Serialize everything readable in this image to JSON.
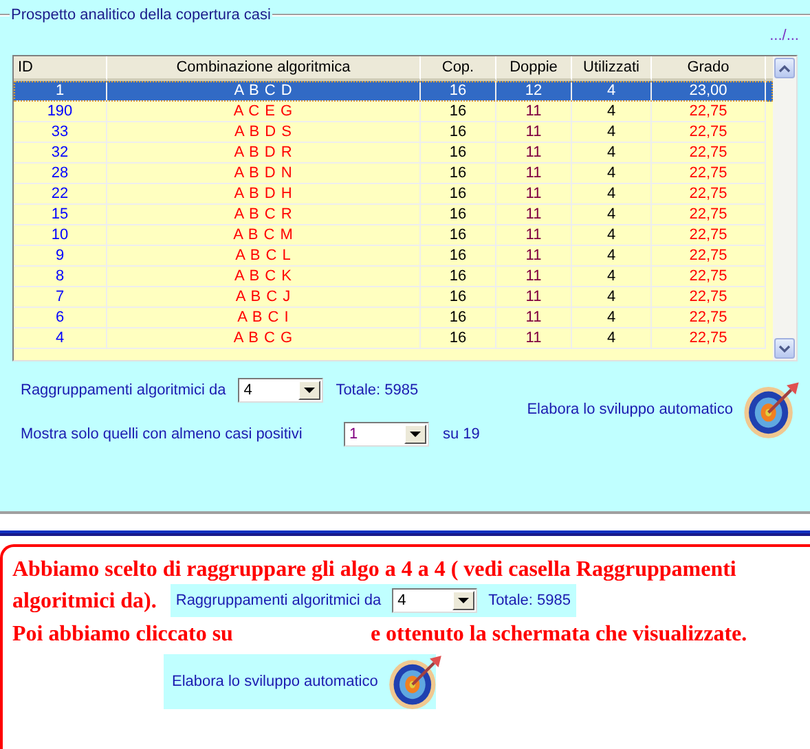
{
  "panel": {
    "title": "Prospetto analitico della copertura casi",
    "link": ".../...",
    "table": {
      "columns": [
        "ID",
        "Combinazione algoritmica",
        "Cop.",
        "Doppie",
        "Utilizzati",
        "Grado"
      ],
      "rows": [
        {
          "cells": [
            "1",
            "A B C D",
            "16",
            "12",
            "4",
            "23,00"
          ],
          "selected": true
        },
        {
          "cells": [
            "190",
            "A C E G",
            "16",
            "11",
            "4",
            "22,75"
          ],
          "selected": false
        },
        {
          "cells": [
            "33",
            "A B D S",
            "16",
            "11",
            "4",
            "22,75"
          ],
          "selected": false
        },
        {
          "cells": [
            "32",
            "A B D R",
            "16",
            "11",
            "4",
            "22,75"
          ],
          "selected": false
        },
        {
          "cells": [
            "28",
            "A B D N",
            "16",
            "11",
            "4",
            "22,75"
          ],
          "selected": false
        },
        {
          "cells": [
            "22",
            "A B D H",
            "16",
            "11",
            "4",
            "22,75"
          ],
          "selected": false
        },
        {
          "cells": [
            "15",
            "A B C R",
            "16",
            "11",
            "4",
            "22,75"
          ],
          "selected": false
        },
        {
          "cells": [
            "10",
            "A B C M",
            "16",
            "11",
            "4",
            "22,75"
          ],
          "selected": false
        },
        {
          "cells": [
            "9",
            "A B C L",
            "16",
            "11",
            "4",
            "22,75"
          ],
          "selected": false
        },
        {
          "cells": [
            "8",
            "A B C K",
            "16",
            "11",
            "4",
            "22,75"
          ],
          "selected": false
        },
        {
          "cells": [
            "7",
            "A B C J",
            "16",
            "11",
            "4",
            "22,75"
          ],
          "selected": false
        },
        {
          "cells": [
            "6",
            "A B C I",
            "16",
            "11",
            "4",
            "22,75"
          ],
          "selected": false
        },
        {
          "cells": [
            "4",
            "A B C G",
            "16",
            "11",
            "4",
            "22,75"
          ],
          "selected": false
        }
      ]
    },
    "grouping": {
      "label": "Raggruppamenti algoritmici da",
      "value": "4",
      "total": "Totale: 5985"
    },
    "filter": {
      "label": "Mostra solo quelli con almeno casi positivi",
      "value": "1",
      "suffix": "su 19"
    },
    "action": {
      "label": "Elabora lo sviluppo automatico"
    }
  },
  "note": {
    "sentence_lines": [
      "Abbiamo scelto di raggruppare gli algo a 4 a 4 ( vedi casella Raggruppamenti",
      "algoritmici da)."
    ],
    "grouping": {
      "label": "Raggruppamenti algoritmici da",
      "value": "4",
      "total": "Totale: 5985"
    },
    "before": "Poi abbiamo cliccato su",
    "after": "e ottenuto la schermata che visualizzate.",
    "action": {
      "label": "Elabora lo sviluppo automatico"
    }
  }
}
